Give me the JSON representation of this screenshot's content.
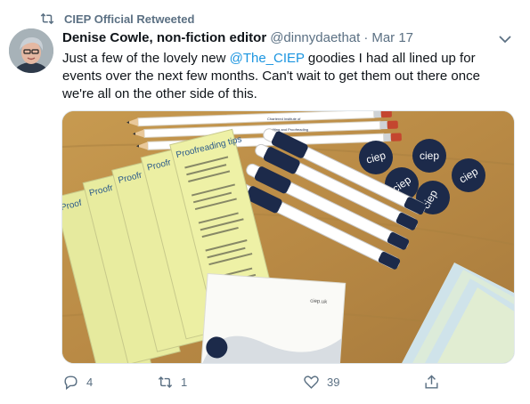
{
  "retweet_banner": {
    "text": "CIEP Official Retweeted",
    "icon": "retweet-icon"
  },
  "author": {
    "name": "Denise Cowle, non-fiction editor",
    "handle": "@dinnydaethat",
    "separator": "·",
    "date": "Mar 17"
  },
  "tweet": {
    "text_before": "Just a few of the lovely new ",
    "mention": "@The_CIEP",
    "text_after": " goodies I had all lined up for events over the next few months. Can't wait to get them out there once we're all on the other side of this."
  },
  "media": {
    "pencil_text": [
      "Chartered Institute of",
      "Editing and Proofreading"
    ],
    "badge_text": "ciep",
    "bookmark_title": "Proofreading tips",
    "bookmark_tabs": [
      "Proof",
      "Proofr",
      "Proofr",
      "Proofr"
    ],
    "notepad_url": "ciep.uk"
  },
  "actions": {
    "reply_count": "4",
    "retweet_count": "1",
    "like_count": "39"
  },
  "colors": {
    "accent": "#1b95e0",
    "muted": "#5b7083",
    "navy": "#1c2a4a",
    "table": "#b9934f"
  }
}
